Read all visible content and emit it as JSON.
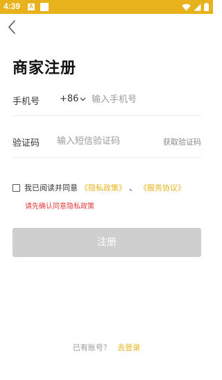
{
  "status_bar": {
    "time": "4:39",
    "notification_letter": "A",
    "background_color": "#e8b21c"
  },
  "header": {
    "back_icon": "chevron-left-icon",
    "title": "商家注册"
  },
  "form": {
    "phone": {
      "label": "手机号",
      "country_code": "+86",
      "placeholder": "输入手机号",
      "value": ""
    },
    "code": {
      "label": "验证码",
      "placeholder": "输入短信验证码",
      "value": "",
      "get_code_label": "获取验证码"
    },
    "agreement": {
      "checked": false,
      "text": "我已阅读并同意",
      "privacy_link": "《隐私政策》",
      "separator": "、",
      "service_link": "《服务协议》",
      "warning": "请先确认同意隐私政策"
    },
    "submit_label": "注册"
  },
  "footer": {
    "prompt": "已有账号？",
    "login_link": "去登录"
  },
  "colors": {
    "accent": "#e8b21c",
    "warning": "#e23b3b",
    "disabled_button": "#cfcfcf"
  }
}
